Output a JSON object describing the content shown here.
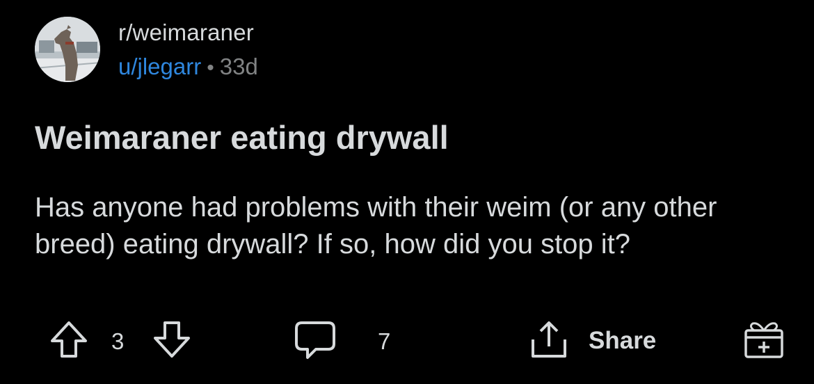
{
  "post": {
    "subreddit": "r/weimaraner",
    "author": "u/jlegarr",
    "separator": "•",
    "age": "33d",
    "title": "Weimaraner eating drywall",
    "body": "Has anyone had problems with their weim (or any other breed) eating drywall? If so, how did you stop it?"
  },
  "actions": {
    "score": "3",
    "comment_count": "7",
    "share_label": "Share"
  },
  "icons": {
    "upvote": "arrow-up-icon",
    "downvote": "arrow-down-icon",
    "comment": "comment-bubble-icon",
    "share": "share-icon",
    "award": "gift-icon"
  },
  "colors": {
    "background": "#000000",
    "text": "#d7dadc",
    "username": "#2f87de",
    "muted": "#818384"
  }
}
